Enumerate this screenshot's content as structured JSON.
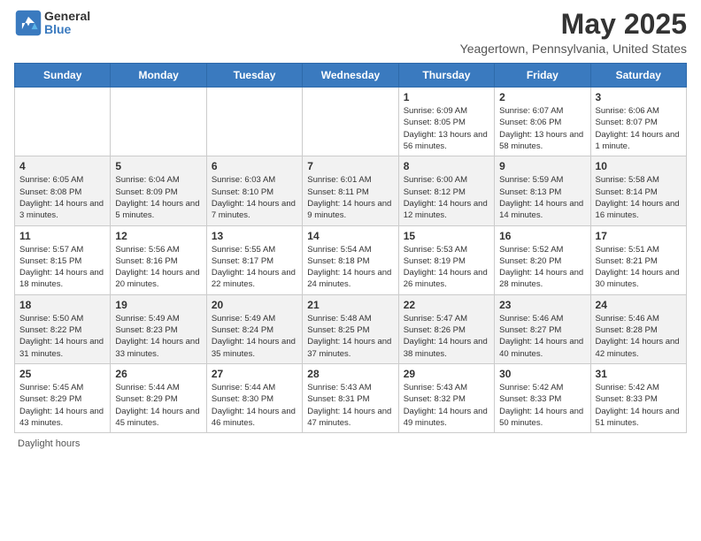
{
  "header": {
    "logo_general": "General",
    "logo_blue": "Blue",
    "month": "May 2025",
    "location": "Yeagertown, Pennsylvania, United States"
  },
  "days_of_week": [
    "Sunday",
    "Monday",
    "Tuesday",
    "Wednesday",
    "Thursday",
    "Friday",
    "Saturday"
  ],
  "weeks": [
    [
      {
        "day": "",
        "info": ""
      },
      {
        "day": "",
        "info": ""
      },
      {
        "day": "",
        "info": ""
      },
      {
        "day": "",
        "info": ""
      },
      {
        "day": "1",
        "info": "Sunrise: 6:09 AM\nSunset: 8:05 PM\nDaylight: 13 hours and 56 minutes."
      },
      {
        "day": "2",
        "info": "Sunrise: 6:07 AM\nSunset: 8:06 PM\nDaylight: 13 hours and 58 minutes."
      },
      {
        "day": "3",
        "info": "Sunrise: 6:06 AM\nSunset: 8:07 PM\nDaylight: 14 hours and 1 minute."
      }
    ],
    [
      {
        "day": "4",
        "info": "Sunrise: 6:05 AM\nSunset: 8:08 PM\nDaylight: 14 hours and 3 minutes."
      },
      {
        "day": "5",
        "info": "Sunrise: 6:04 AM\nSunset: 8:09 PM\nDaylight: 14 hours and 5 minutes."
      },
      {
        "day": "6",
        "info": "Sunrise: 6:03 AM\nSunset: 8:10 PM\nDaylight: 14 hours and 7 minutes."
      },
      {
        "day": "7",
        "info": "Sunrise: 6:01 AM\nSunset: 8:11 PM\nDaylight: 14 hours and 9 minutes."
      },
      {
        "day": "8",
        "info": "Sunrise: 6:00 AM\nSunset: 8:12 PM\nDaylight: 14 hours and 12 minutes."
      },
      {
        "day": "9",
        "info": "Sunrise: 5:59 AM\nSunset: 8:13 PM\nDaylight: 14 hours and 14 minutes."
      },
      {
        "day": "10",
        "info": "Sunrise: 5:58 AM\nSunset: 8:14 PM\nDaylight: 14 hours and 16 minutes."
      }
    ],
    [
      {
        "day": "11",
        "info": "Sunrise: 5:57 AM\nSunset: 8:15 PM\nDaylight: 14 hours and 18 minutes."
      },
      {
        "day": "12",
        "info": "Sunrise: 5:56 AM\nSunset: 8:16 PM\nDaylight: 14 hours and 20 minutes."
      },
      {
        "day": "13",
        "info": "Sunrise: 5:55 AM\nSunset: 8:17 PM\nDaylight: 14 hours and 22 minutes."
      },
      {
        "day": "14",
        "info": "Sunrise: 5:54 AM\nSunset: 8:18 PM\nDaylight: 14 hours and 24 minutes."
      },
      {
        "day": "15",
        "info": "Sunrise: 5:53 AM\nSunset: 8:19 PM\nDaylight: 14 hours and 26 minutes."
      },
      {
        "day": "16",
        "info": "Sunrise: 5:52 AM\nSunset: 8:20 PM\nDaylight: 14 hours and 28 minutes."
      },
      {
        "day": "17",
        "info": "Sunrise: 5:51 AM\nSunset: 8:21 PM\nDaylight: 14 hours and 30 minutes."
      }
    ],
    [
      {
        "day": "18",
        "info": "Sunrise: 5:50 AM\nSunset: 8:22 PM\nDaylight: 14 hours and 31 minutes."
      },
      {
        "day": "19",
        "info": "Sunrise: 5:49 AM\nSunset: 8:23 PM\nDaylight: 14 hours and 33 minutes."
      },
      {
        "day": "20",
        "info": "Sunrise: 5:49 AM\nSunset: 8:24 PM\nDaylight: 14 hours and 35 minutes."
      },
      {
        "day": "21",
        "info": "Sunrise: 5:48 AM\nSunset: 8:25 PM\nDaylight: 14 hours and 37 minutes."
      },
      {
        "day": "22",
        "info": "Sunrise: 5:47 AM\nSunset: 8:26 PM\nDaylight: 14 hours and 38 minutes."
      },
      {
        "day": "23",
        "info": "Sunrise: 5:46 AM\nSunset: 8:27 PM\nDaylight: 14 hours and 40 minutes."
      },
      {
        "day": "24",
        "info": "Sunrise: 5:46 AM\nSunset: 8:28 PM\nDaylight: 14 hours and 42 minutes."
      }
    ],
    [
      {
        "day": "25",
        "info": "Sunrise: 5:45 AM\nSunset: 8:29 PM\nDaylight: 14 hours and 43 minutes."
      },
      {
        "day": "26",
        "info": "Sunrise: 5:44 AM\nSunset: 8:29 PM\nDaylight: 14 hours and 45 minutes."
      },
      {
        "day": "27",
        "info": "Sunrise: 5:44 AM\nSunset: 8:30 PM\nDaylight: 14 hours and 46 minutes."
      },
      {
        "day": "28",
        "info": "Sunrise: 5:43 AM\nSunset: 8:31 PM\nDaylight: 14 hours and 47 minutes."
      },
      {
        "day": "29",
        "info": "Sunrise: 5:43 AM\nSunset: 8:32 PM\nDaylight: 14 hours and 49 minutes."
      },
      {
        "day": "30",
        "info": "Sunrise: 5:42 AM\nSunset: 8:33 PM\nDaylight: 14 hours and 50 minutes."
      },
      {
        "day": "31",
        "info": "Sunrise: 5:42 AM\nSunset: 8:33 PM\nDaylight: 14 hours and 51 minutes."
      }
    ]
  ],
  "footer": {
    "note": "Daylight hours"
  }
}
